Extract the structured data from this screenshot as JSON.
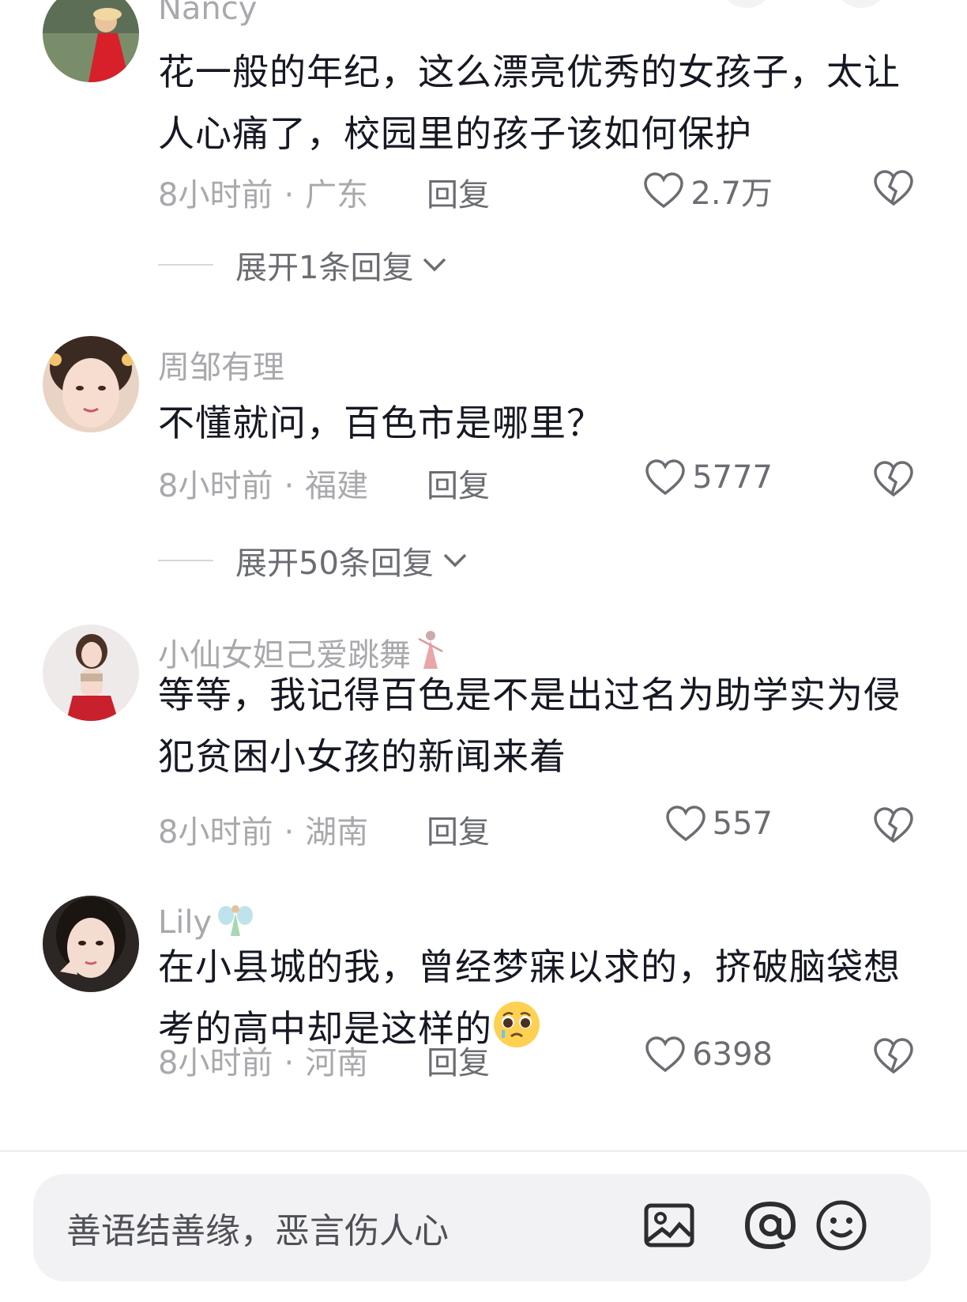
{
  "comments": [
    {
      "username": "Nancy",
      "content": "花一般的年纪，这么漂亮优秀的女孩子，太让人心痛了，校园里的孩子该如何保护",
      "time": "8小时前",
      "location": "广东",
      "reply_label": "回复",
      "likes": "2.7万",
      "expand_label": "展开1条回复"
    },
    {
      "username": "周邹有理",
      "content": "不懂就问，百色市是哪里？",
      "time": "8小时前",
      "location": "福建",
      "reply_label": "回复",
      "likes": "5777",
      "expand_label": "展开50条回复"
    },
    {
      "username": "小仙女妲己爱跳舞",
      "content": "等等，我记得百色是不是出过名为助学实为侵犯贫困小女孩的新闻来着",
      "time": "8小时前",
      "location": "湖南",
      "reply_label": "回复",
      "likes": "557"
    },
    {
      "username": "Lily",
      "content": "在小县城的我，曾经梦寐以求的，挤破脑袋想考的高中却是这样的",
      "time": "8小时前",
      "location": "河南",
      "reply_label": "回复",
      "likes": "6398"
    }
  ],
  "separator": "·",
  "comment_input": {
    "placeholder": "善语结善缘，恶言伤人心"
  },
  "icons": {
    "like": "heart-outline-icon",
    "dislike": "broken-heart-icon",
    "expand": "chevron-down-icon",
    "image": "image-icon",
    "mention": "at-icon",
    "emoji": "smiley-icon",
    "inline_emoji": "pleading-face-emoji"
  }
}
